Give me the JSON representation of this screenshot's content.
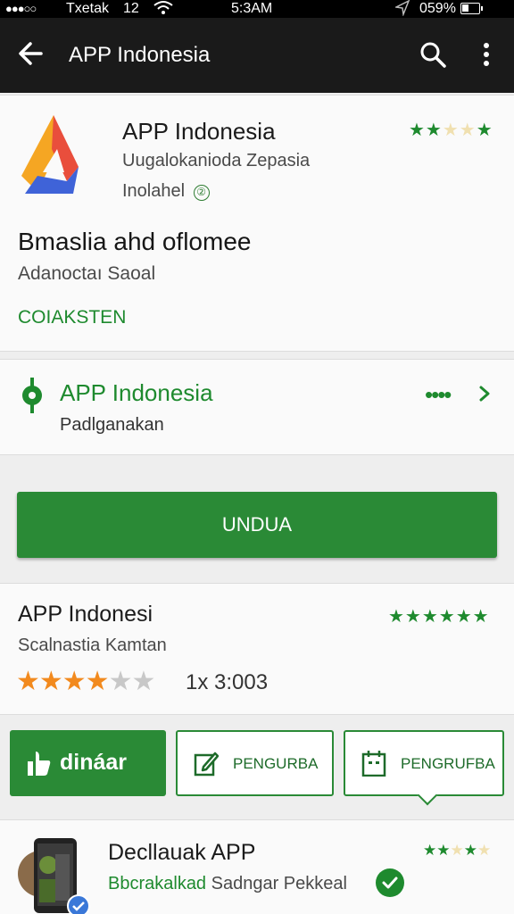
{
  "status_bar": {
    "dots": "●●●○○",
    "carrier": "Txetak",
    "signal": "12",
    "time": "5:3AM",
    "battery": "059%"
  },
  "app_bar": {
    "title": "APP Indonesia"
  },
  "app_card": {
    "title": "APP Indonesia",
    "subtitle": "Uugalokanioda Zepasia",
    "install_status": "Inolahel",
    "info_glyph": "②",
    "rating_stars": "★★★★★",
    "stars_filled": 2,
    "stars_total": 5,
    "heading": "Bmaslia ahd oflomee",
    "subheading": "Adanoctaı Saoal",
    "link": "COIAKSTEN"
  },
  "developer": {
    "name": "APP Indonesia",
    "sub": "Padlganakan",
    "dots": "••••"
  },
  "install_button": {
    "label": "UNDUA"
  },
  "rating_card": {
    "title": "APP Indonesi",
    "subtitle": "Scalnastia Kamtan",
    "top_stars": "★★★★★★",
    "stars_value": 3.5,
    "stars_total": 5,
    "count": "1x 3:003"
  },
  "actions": [
    {
      "label": "dináar",
      "icon": "thumb-icon"
    },
    {
      "label": "PENGURBA",
      "icon": "edit-icon"
    },
    {
      "label": "PENGRUFBA",
      "icon": "calendar-icon"
    }
  ],
  "recommendation": {
    "title": "Decllauak APP",
    "sub_green": "Bbcrakalkad",
    "sub_gray": " Sadngar Pekkeal",
    "stars_filled": 2,
    "stars_total": 5
  },
  "colors": {
    "accent_green": "#2a8a36",
    "star_orange": "#f28a1e",
    "app_bar": "#1a1a1a"
  }
}
